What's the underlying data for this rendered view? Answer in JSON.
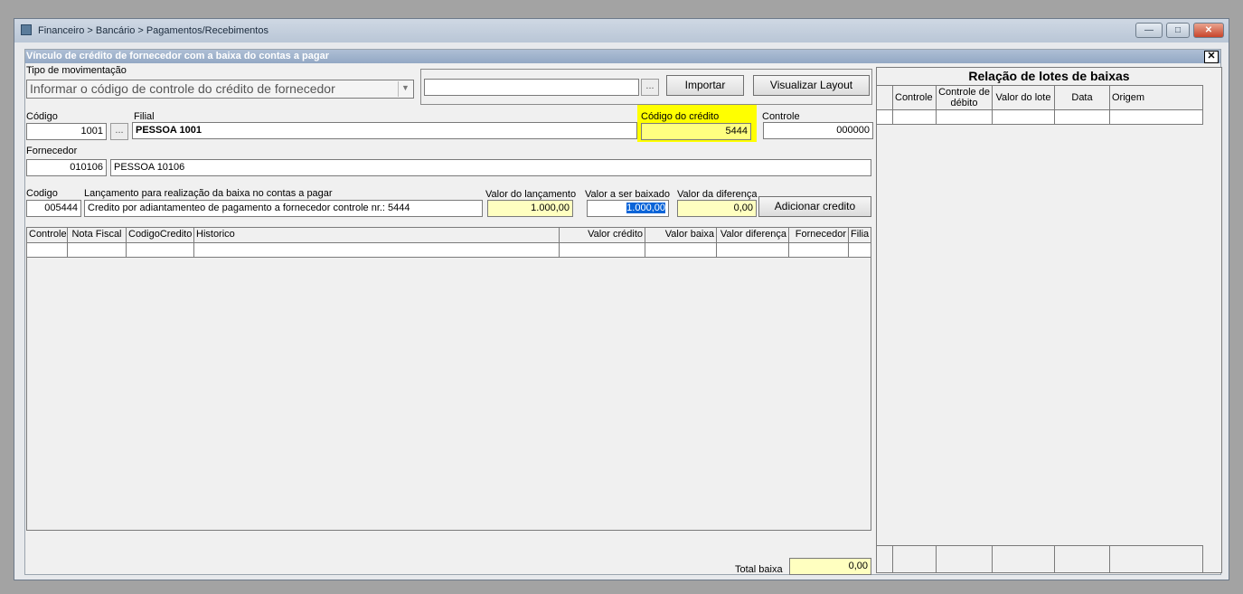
{
  "window": {
    "title": "Financeiro > Bancário > Pagamentos/Recebimentos",
    "controls": {
      "minimize": "—",
      "maximize": "□",
      "close": "✕"
    }
  },
  "form": {
    "header": "Vínculo de crédito de fornecedor com a baixa do contas a pagar",
    "close_glyph": "✕",
    "tipo_mov_label": "Tipo de  movimentação",
    "tipo_mov_value": "Informar o código de controle do crédito de fornecedor",
    "file_path_value": "",
    "browse_label": "...",
    "importar_label": "Importar",
    "layout_label": "Visualizar Layout",
    "codigo_label": "Código",
    "codigo_value": "1001",
    "filial_label": "Filial",
    "filial_value": "PESSOA 1001",
    "cod_credito_label": "Código do crédito",
    "cod_credito_value": "5444",
    "controle_label": "Controle",
    "controle_value": "000000",
    "fornecedor_label": "Fornecedor",
    "fornecedor_code": "010106",
    "fornecedor_name": "PESSOA 10106",
    "cod2_label": "Codigo",
    "cod2_value": "005444",
    "lanc_label": "Lançamento para realização da baixa no contas a pagar",
    "lanc_value": "Credito por adiantamenteo de pagamento a fornecedor controle nr.: 5444",
    "valor_lanc_label": "Valor do lançamento",
    "valor_lanc_value": "1.000,00",
    "valor_baixar_label": "Valor a ser baixado",
    "valor_baixar_value": "1.000,00",
    "valor_dif_label": "Valor da diferença",
    "valor_dif_value": "0,00",
    "add_credito_label": "Adicionar credito",
    "total_baixa_label": "Total baixa",
    "total_baixa_value": "0,00"
  },
  "main_grid": {
    "columns": [
      "Controle",
      "Nota Fiscal",
      "CodigoCredito",
      "Historico",
      "Valor crédito",
      "Valor baixa",
      "Valor diferença",
      "Fornecedor",
      "Filia"
    ]
  },
  "lotes": {
    "title": "Relação de lotes de baixas",
    "columns": [
      "Controle",
      "Controle de débito",
      "Valor do lote",
      "Data",
      "Origem"
    ]
  },
  "colors": {
    "highlight": "#ffff00",
    "readonly_yellow": "#ffffc0",
    "selection": "#0a64d8"
  }
}
